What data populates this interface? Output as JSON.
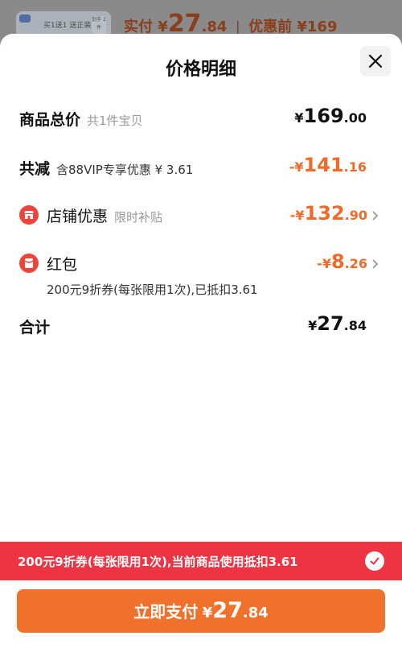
{
  "background": {
    "product_badge": "买1送1 送正装",
    "product_tag": "划手 2件",
    "paid_label": "实付",
    "paid_currency": "¥",
    "paid_int": "27",
    "paid_dec": ".84",
    "before_label": "优惠前",
    "before_price": "¥169"
  },
  "sheet": {
    "title": "价格明细",
    "total": {
      "label": "商品总价",
      "sub": "共1件宝贝",
      "currency": "¥",
      "int": "169",
      "dec": ".00"
    },
    "reduced": {
      "label": "共减",
      "sub": "含88VIP专享优惠 ¥ 3.61",
      "currency": "-¥",
      "int": "141",
      "dec": ".16"
    },
    "shop_discount": {
      "label": "店铺优惠",
      "sub": "限时补贴",
      "currency": "-¥",
      "int": "132",
      "dec": ".90"
    },
    "red_packet": {
      "label": "红包",
      "desc": "200元9折券(每张限用1次),已抵扣3.61",
      "currency": "-¥",
      "int": "8",
      "dec": ".26"
    },
    "sum": {
      "label": "合计",
      "currency": "¥",
      "int": "27",
      "dec": ".84"
    }
  },
  "notice": {
    "text": "200元9折券(每张限用1次),当前商品使用抵扣3.61"
  },
  "pay_button": {
    "label": "立即支付",
    "currency": "¥",
    "int": "27",
    "dec": ".84"
  },
  "colors": {
    "accent_orange": "#f0712b",
    "discount_orange": "#f06a2a",
    "notice_red": "#ee3343"
  }
}
